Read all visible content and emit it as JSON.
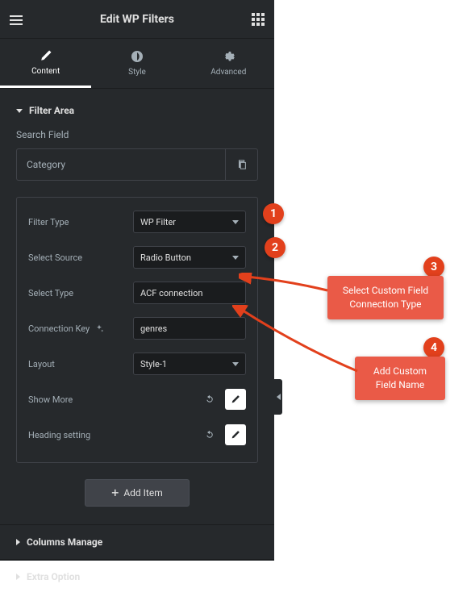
{
  "header": {
    "title": "Edit WP Filters"
  },
  "tabs": {
    "content": "Content",
    "style": "Style",
    "advanced": "Advanced"
  },
  "sections": {
    "filter_area": "Filter Area",
    "columns_manage": "Columns Manage",
    "extra_option": "Extra Option"
  },
  "search_field_label": "Search Field",
  "item_name": "Category",
  "fields": {
    "filter_type": {
      "label": "Filter Type",
      "value": "WP Filter"
    },
    "select_source": {
      "label": "Select Source",
      "value": "Radio Button"
    },
    "select_type": {
      "label": "Select Type",
      "value": "ACF connection"
    },
    "connection_key": {
      "label": "Connection Key",
      "value": "genres"
    },
    "layout": {
      "label": "Layout",
      "value": "Style-1"
    },
    "show_more": {
      "label": "Show More"
    },
    "heading_setting": {
      "label": "Heading setting"
    }
  },
  "add_item": "Add Item",
  "annotations": {
    "b1": "1",
    "b2": "2",
    "b3": "3",
    "b4": "4",
    "callout1": "Select Custom Field Connection Type",
    "callout2": "Add Custom Field Name"
  }
}
